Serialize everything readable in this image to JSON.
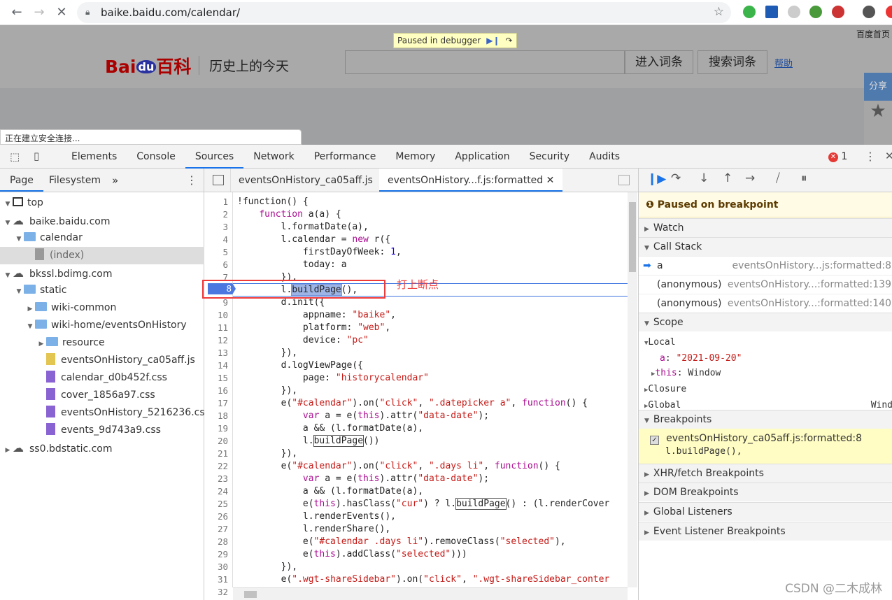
{
  "browser": {
    "url": "baike.baidu.com/calendar/",
    "icons": [
      "back-icon",
      "forward-icon",
      "stop-icon",
      "lock-icon",
      "bookmark-star-icon",
      "profile-icon"
    ]
  },
  "page": {
    "logo_text": "Bai du 百科",
    "site_title": "历史上的今天",
    "enter_button": "进入词条",
    "search_button": "搜索词条",
    "help_link": "帮助",
    "home_link": "百度首页",
    "share_label": "分享",
    "paused_banner": "Paused in debugger",
    "status_text": "正在建立安全连接..."
  },
  "devtools": {
    "tabs": [
      "Elements",
      "Console",
      "Sources",
      "Network",
      "Performance",
      "Memory",
      "Application",
      "Security",
      "Audits"
    ],
    "active_tab": "Sources",
    "error_count": "1",
    "navigator_tabs": [
      "Page",
      "Filesystem"
    ],
    "more_tabs": "»",
    "file_tabs": [
      "eventsOnHistory_ca05aff.js",
      "eventsOnHistory...f.js:formatted"
    ],
    "tree": [
      {
        "label": "top",
        "level": 0,
        "type": "frame",
        "open": true
      },
      {
        "label": "baike.baidu.com",
        "level": 0,
        "type": "cloud",
        "open": true
      },
      {
        "label": "calendar",
        "level": 1,
        "type": "folder",
        "open": true
      },
      {
        "label": "(index)",
        "level": 2,
        "type": "doc",
        "selected": true
      },
      {
        "label": "bkssl.bdimg.com",
        "level": 0,
        "type": "cloud",
        "open": true
      },
      {
        "label": "static",
        "level": 1,
        "type": "folder",
        "open": true
      },
      {
        "label": "wiki-common",
        "level": 2,
        "type": "folder",
        "open": false
      },
      {
        "label": "wiki-home/eventsOnHistory",
        "level": 2,
        "type": "folder",
        "open": true
      },
      {
        "label": "resource",
        "level": 3,
        "type": "folder",
        "open": false
      },
      {
        "label": "eventsOnHistory_ca05aff.js",
        "level": 3,
        "type": "js"
      },
      {
        "label": "calendar_d0b452f.css",
        "level": 3,
        "type": "css"
      },
      {
        "label": "cover_1856a97.css",
        "level": 3,
        "type": "css"
      },
      {
        "label": "eventsOnHistory_5216236.css",
        "level": 3,
        "type": "css"
      },
      {
        "label": "events_9d743a9.css",
        "level": 3,
        "type": "css"
      },
      {
        "label": "ss0.bdstatic.com",
        "level": 0,
        "type": "cloud",
        "open": false
      }
    ],
    "code": [
      "!function() {",
      "    function a(a) {",
      "        l.formatDate(a),",
      "        l.calendar = new r({",
      "            firstDayOfWeek: 1,",
      "            today: a",
      "        }),",
      "        l.buildPage(),",
      "        d.init({",
      "            appname: \"baike\",",
      "            platform: \"web\",",
      "            device: \"pc\"",
      "        }),",
      "        d.logViewPage({",
      "            page: \"historycalendar\"",
      "        }),",
      "        e(\"#calendar\").on(\"click\", \".datepicker a\", function() {",
      "            var a = e(this).attr(\"data-date\");",
      "            a && (l.formatDate(a),",
      "            l.buildPage())",
      "        }),",
      "        e(\"#calendar\").on(\"click\", \".days li\", function() {",
      "            var a = e(this).attr(\"data-date\");",
      "            a && (l.formatDate(a),",
      "            e(this).hasClass(\"cur\") ? l.buildPage() : (l.renderCover",
      "            l.renderEvents(),",
      "            l.renderShare(),",
      "            e(\"#calendar .days li\").removeClass(\"selected\"),",
      "            e(this).addClass(\"selected\")))",
      "        }),",
      "        e(\".wgt-shareSidebar\").on(\"click\", \".wgt-shareSidebar_conter",
      ""
    ],
    "breakpoint_line": 8,
    "annotation": "打上断点",
    "debugger": {
      "paused_message": "Paused on breakpoint",
      "watch": "Watch",
      "call_stack": "Call Stack",
      "frames": [
        {
          "name": "a",
          "location": "eventsOnHistory...js:formatted:8",
          "current": true
        },
        {
          "name": "(anonymous)",
          "location": "eventsOnHistory...:formatted:139"
        },
        {
          "name": "(anonymous)",
          "location": "eventsOnHistory...:formatted:140"
        }
      ],
      "scope": "Scope",
      "local": "Local",
      "local_a_key": "a",
      "local_a_value": "\"2021-09-20\"",
      "this_key": "this",
      "this_value": "Window",
      "closure": "Closure",
      "global": "Global",
      "global_value": "Wind",
      "breakpoints": "Breakpoints",
      "bp_file": "eventsOnHistory_ca05aff.js:formatted:8",
      "bp_code": "l.buildPage(),",
      "xhr": "XHR/fetch Breakpoints",
      "dom": "DOM Breakpoints",
      "global_listeners": "Global Listeners",
      "event_listeners": "Event Listener Breakpoints"
    }
  },
  "watermark": "CSDN @二木成林"
}
